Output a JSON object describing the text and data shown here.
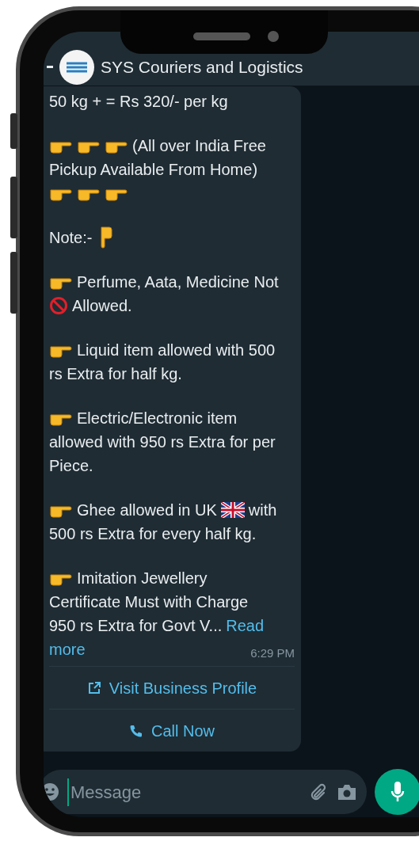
{
  "header": {
    "title": "SYS Couriers and Logistics"
  },
  "message": {
    "paragraphs": [
      {
        "lines": [
          [
            {
              "kind": "text",
              "text": "50 kg + = Rs 320/- per kg"
            }
          ]
        ]
      },
      {
        "lines": [
          [
            {
              "kind": "hand-right"
            },
            {
              "kind": "hand-right"
            },
            {
              "kind": "hand-right"
            },
            {
              "kind": "text",
              "text": "(All over India Free"
            }
          ],
          [
            {
              "kind": "text",
              "text": "Pickup Available From Home)"
            }
          ],
          [
            {
              "kind": "hand-right"
            },
            {
              "kind": "hand-right"
            },
            {
              "kind": "hand-right"
            }
          ]
        ]
      },
      {
        "lines": [
          [
            {
              "kind": "text",
              "text": "Note:-"
            },
            {
              "kind": "hand-down"
            }
          ]
        ]
      },
      {
        "lines": [
          [
            {
              "kind": "hand-right"
            },
            {
              "kind": "text",
              "text": "Perfume, Aata, Medicine Not"
            }
          ],
          [
            {
              "kind": "no-entry"
            },
            {
              "kind": "text",
              "text": "Allowed."
            }
          ]
        ]
      },
      {
        "lines": [
          [
            {
              "kind": "hand-right"
            },
            {
              "kind": "text",
              "text": "Liquid item allowed with 500"
            }
          ],
          [
            {
              "kind": "text",
              "text": "rs Extra for half kg."
            }
          ]
        ]
      },
      {
        "lines": [
          [
            {
              "kind": "hand-right"
            },
            {
              "kind": "text",
              "text": "Electric/Electronic item"
            }
          ],
          [
            {
              "kind": "text",
              "text": "allowed with 950 rs Extra for per"
            }
          ],
          [
            {
              "kind": "text",
              "text": "Piece."
            }
          ]
        ]
      },
      {
        "lines": [
          [
            {
              "kind": "hand-right"
            },
            {
              "kind": "text",
              "text": "Ghee allowed in UK"
            },
            {
              "kind": "flag"
            },
            {
              "kind": "text",
              "text": "with"
            }
          ],
          [
            {
              "kind": "text",
              "text": "500 rs Extra for every half kg."
            }
          ]
        ]
      },
      {
        "lines": [
          [
            {
              "kind": "hand-right"
            },
            {
              "kind": "text",
              "text": "Imitation Jewellery"
            }
          ],
          [
            {
              "kind": "text",
              "text": "Certificate Must with Charge"
            }
          ],
          [
            {
              "kind": "text",
              "text": "950 rs Extra for Govt V..."
            },
            {
              "kind": "link",
              "text": "Read"
            }
          ],
          [
            {
              "kind": "link",
              "text": "more"
            }
          ]
        ]
      }
    ],
    "time": "6:29 PM"
  },
  "actions": [
    {
      "kind": "link",
      "label": "Visit Business Profile"
    },
    {
      "kind": "call",
      "label": "Call Now"
    }
  ],
  "composer": {
    "placeholder": "Message"
  }
}
